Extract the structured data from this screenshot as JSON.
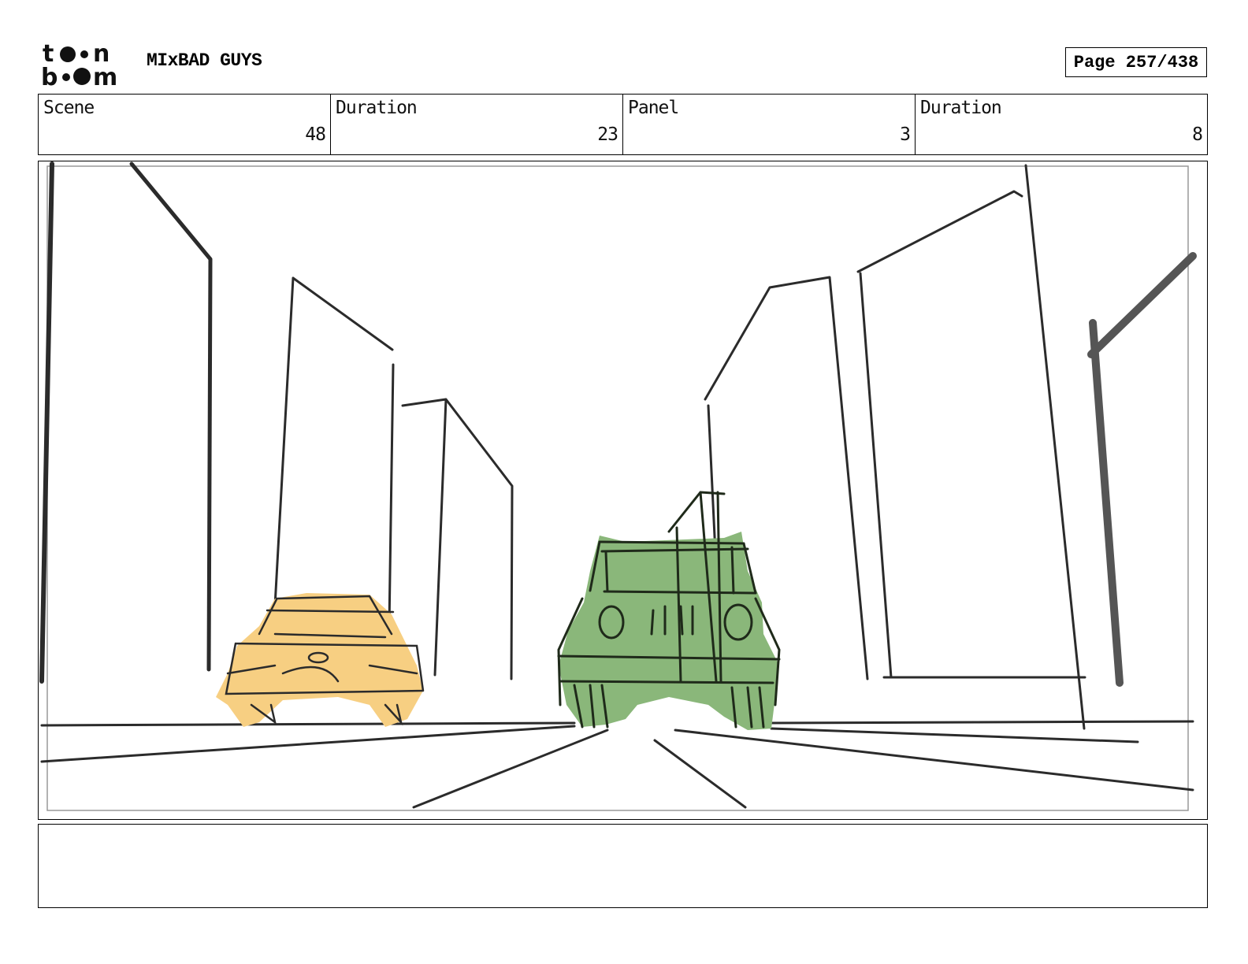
{
  "header": {
    "logo": {
      "line1": "toon",
      "line2": "boom"
    },
    "project_title": "MIxBAD GUYS",
    "page_label": "Page",
    "page_number": "257/438"
  },
  "info": {
    "scene": {
      "label": "Scene",
      "value": "48"
    },
    "scene_duration": {
      "label": "Duration",
      "value": "23"
    },
    "panel": {
      "label": "Panel",
      "value": "3"
    },
    "panel_duration": {
      "label": "Duration",
      "value": "8"
    }
  },
  "drawing": {
    "yellow_car_color": "#f7cf82",
    "green_car_color": "#8ab77a",
    "line_color": "#2b2b2b"
  },
  "caption": {
    "text": ""
  }
}
